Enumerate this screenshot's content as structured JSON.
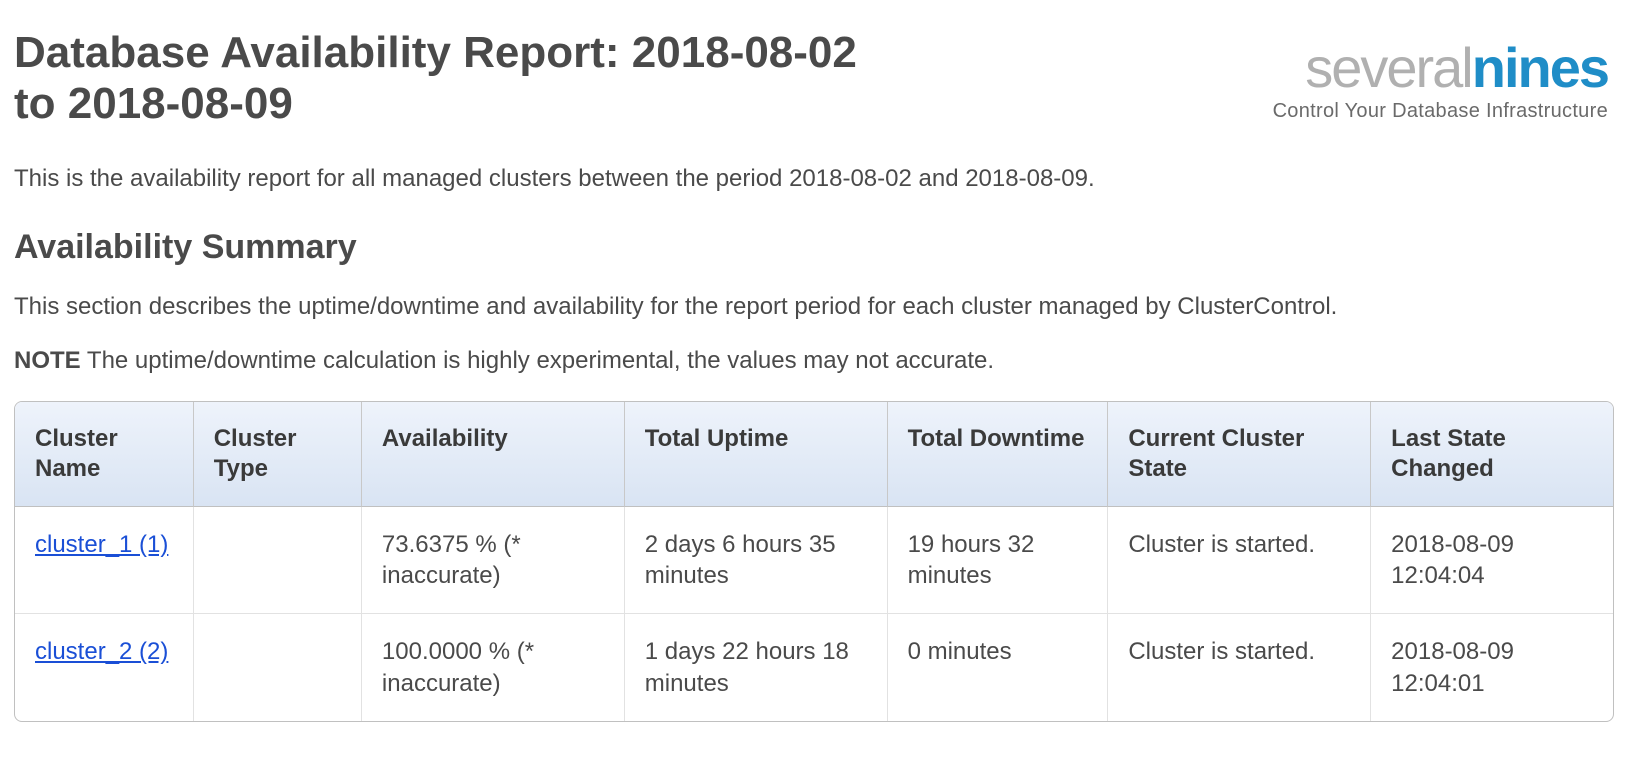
{
  "header": {
    "title": "Database Availability Report: 2018-08-02 to 2018-08-09",
    "logo_gray": "several",
    "logo_blue": "nines",
    "tagline": "Control Your Database Infrastructure"
  },
  "intro": "This is the availability report for all managed clusters between the period 2018-08-02 and 2018-08-09.",
  "summary": {
    "heading": "Availability Summary",
    "description": "This section describes the uptime/downtime and availability for the report period for each cluster managed by ClusterControl.",
    "note_label": "NOTE",
    "note_text": " The uptime/downtime calculation is highly experimental, the values may not accurate."
  },
  "table": {
    "headers": [
      "Cluster Name",
      "Cluster Type",
      "Availability",
      "Total Uptime",
      "Total Downtime",
      "Current Cluster State",
      "Last State Changed"
    ],
    "rows": [
      {
        "cluster_name": "cluster_1 (1)",
        "cluster_type": "",
        "availability": "73.6375 % (* inaccurate)",
        "total_uptime": "2 days 6 hours 35 minutes",
        "total_downtime": "19 hours 32 minutes",
        "current_state": "Cluster is started.",
        "last_changed": "2018-08-09 12:04:04"
      },
      {
        "cluster_name": "cluster_2 (2)",
        "cluster_type": "",
        "availability": "100.0000 % (* inaccurate)",
        "total_uptime": "1 days 22 hours 18 minutes",
        "total_downtime": "0 minutes",
        "current_state": "Cluster is started.",
        "last_changed": "2018-08-09 12:04:01"
      }
    ]
  }
}
